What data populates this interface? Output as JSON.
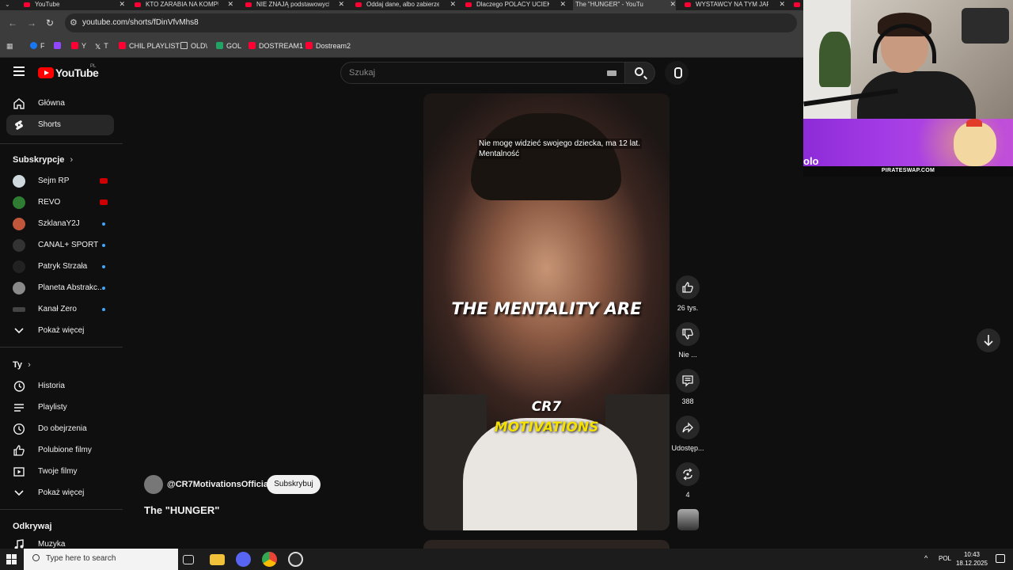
{
  "browser": {
    "tabs": [
      {
        "title": "YouTube",
        "active": false
      },
      {
        "title": "KTO ZARABIA NA KOMPU",
        "active": false
      },
      {
        "title": "NIE ZNAJĄ podstawowych",
        "active": false
      },
      {
        "title": "Oddaj dane, albo zabierzem",
        "active": false
      },
      {
        "title": "Dlaczego POLACY UCIEKA",
        "active": false
      },
      {
        "title": "The \"HUNGER\" - YouTu",
        "active": true
      },
      {
        "title": "WYSTAWCY NA TYM JARM",
        "active": false
      }
    ],
    "url": "youtube.com/shorts/fDinVfvMhs8",
    "bookmarks": [
      {
        "label": "F",
        "color": "#1877f2"
      },
      {
        "label": "",
        "color": "#9146ff"
      },
      {
        "label": "Y",
        "color": "#ff0033"
      },
      {
        "label": "T",
        "color": "#ffffff"
      },
      {
        "label": "CHIL PLAYLIST",
        "color": "#ff0033"
      },
      {
        "label": "OLD\\",
        "color": "#cccccc"
      },
      {
        "label": "GOL",
        "color": "#21a366"
      },
      {
        "label": "DOSTREAM1",
        "color": "#ff0033"
      },
      {
        "label": "Dostream2",
        "color": "#ff0033"
      }
    ]
  },
  "youtube": {
    "logo_text": "YouTube",
    "country_code": "PL",
    "search_placeholder": "Szukaj",
    "sidebar": {
      "main": [
        {
          "label": "Główna",
          "icon": "home-icon"
        },
        {
          "label": "Shorts",
          "icon": "shorts-icon",
          "active": true
        }
      ],
      "subscriptions_heading": "Subskrypcje",
      "subscriptions": [
        {
          "label": "Sejm RP",
          "status": "live",
          "avatar_color": "#cfd8dc"
        },
        {
          "label": "REVO",
          "status": "live",
          "avatar_color": "#2e7d32"
        },
        {
          "label": "SzklanaY2J",
          "status": "new",
          "avatar_color": "#c0573a"
        },
        {
          "label": "CANAL+ SPORT",
          "status": "new",
          "avatar_color": "#333333"
        },
        {
          "label": "Patryk Strzała",
          "status": "new",
          "avatar_color": "#222222"
        },
        {
          "label": "Planeta Abstrakc...",
          "status": "new",
          "avatar_color": "#8a8a8a"
        },
        {
          "label": "Kanał Zero",
          "status": "new",
          "avatar_color": "#444444"
        }
      ],
      "show_more": "Pokaż więcej",
      "you_heading": "Ty",
      "you": [
        {
          "label": "Historia",
          "icon": "history-icon"
        },
        {
          "label": "Playlisty",
          "icon": "playlist-icon"
        },
        {
          "label": "Do obejrzenia",
          "icon": "watch-later-icon"
        },
        {
          "label": "Polubione filmy",
          "icon": "like-icon"
        },
        {
          "label": "Twoje filmy",
          "icon": "your-videos-icon"
        }
      ],
      "show_more_2": "Pokaż więcej",
      "explore_heading": "Odkrywaj",
      "explore": [
        {
          "label": "Muzyka",
          "icon": "music-icon"
        }
      ]
    },
    "short": {
      "caption_line1": "Nie mogę widzieć swojego dziecka, ma 12 lat.",
      "caption_line2": "Mentalność",
      "overlay_text": "THE MENTALITY ARE",
      "brand_line1": "CR7",
      "brand_line2": "MOTIVATIONS",
      "channel": "@CR7MotivationsOfficial",
      "subscribe": "Subskrybuj",
      "title": "The \"HUNGER\"",
      "likes": "26 tys.",
      "dislike": "Nie ...",
      "comments": "388",
      "share": "Udostęp...",
      "remix": "4"
    }
  },
  "ad": {
    "logo_fragment": "olo",
    "domain": "PIRATESWAP.COM"
  },
  "taskbar": {
    "search_placeholder": "Type here to search",
    "lang": "POL",
    "time": "10:43",
    "date": "18.12.2025"
  }
}
